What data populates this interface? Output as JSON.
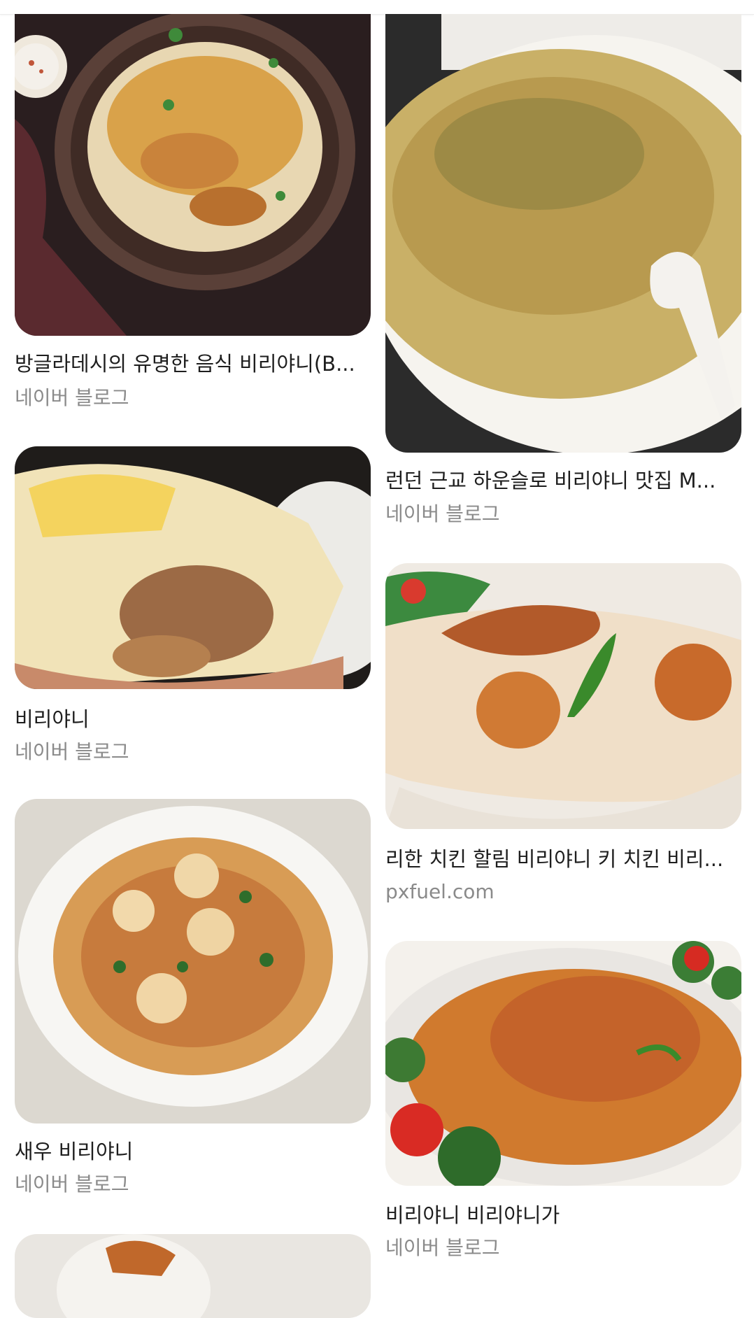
{
  "results": {
    "left": [
      {
        "title": "방글라데시의 유명한 음식 비리야니(B...",
        "source": "네이버 블로그"
      },
      {
        "title": "비리야니",
        "source": "네이버 블로그"
      },
      {
        "title": "새우 비리야니",
        "source": "네이버 블로그"
      }
    ],
    "right": [
      {
        "title": "런던 근교 하운슬로 비리야니 맛집 M...",
        "source": "네이버 블로그"
      },
      {
        "title": "리한 치킨 할림 비리야니 키 치킨 비리...",
        "source": "pxfuel.com"
      },
      {
        "title": "비리야니 비리야니가",
        "source": "네이버 블로그"
      }
    ]
  }
}
